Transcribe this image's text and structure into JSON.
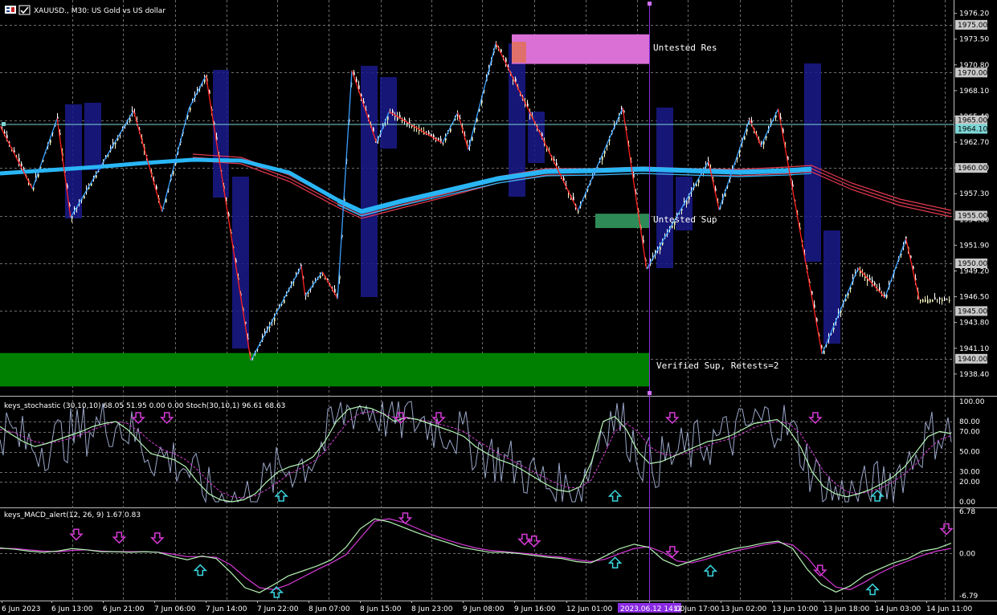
{
  "main_title": "XAUUSD., M30:  US Gold vs US dollar",
  "stoch_title": "keys_stochastic (30,10,10) 68.05 51.95 0.00 0.00 Stoch(30,10,1) 96.61 68.63",
  "macd_title": "keys_MACD_alert(12, 26, 9) 1.67 0.83",
  "zones": {
    "untested_res": "Untested Res",
    "untested_sup": "Untested Sup",
    "verified_sup": "Verified Sup, Retests=2"
  },
  "colors": {
    "background": "#000000",
    "grid": "#6e6e6e",
    "bull_candle": "#f5f5c0",
    "bear_candle": "#ffffff",
    "zigzag_up": "#3aa0ff",
    "zigzag_down": "#ff2020",
    "ma_blue": "#29b6f6",
    "ma_red": "#e53950",
    "res_zone": "#da70d6",
    "sup_zone": "#2e8b57",
    "verified_zone": "#008000",
    "box_fill": "#1a1a8c",
    "price_line": "#7fd7d7",
    "arrow_down": "#d63ad6",
    "arrow_up": "#3ad6e0",
    "stoch_main": "#b5f5b5",
    "stoch_signal": "#d63ad6",
    "stoch_raw": "#9aa6c8",
    "macd_main": "#b5f5b5",
    "macd_signal": "#d63ad6",
    "cursor_line": "#8a2be2",
    "time_highlight": "#8a2be2"
  },
  "chart_data": [
    {
      "type": "candlestick",
      "symbol": "XAUUSD.",
      "timeframe": "M30",
      "ylim": [
        1936.2,
        1977.6
      ],
      "y_ticks": [
        "1976.20",
        "1973.50",
        "1970.80",
        "1968.10",
        "1965.40",
        "1962.70",
        "1960.00",
        "1957.30",
        "1954.60",
        "1951.90",
        "1949.20",
        "1946.50",
        "1943.80",
        "1941.10",
        "1938.40"
      ],
      "price_labels": [
        "1975.00",
        "1970.00",
        "1965.00",
        "1964.10",
        "1960.00",
        "1955.00",
        "1950.00",
        "1945.00",
        "1940.00"
      ],
      "current_price": 1964.1,
      "zigzag_points": [
        {
          "x": 0.0,
          "y": 1964.4
        },
        {
          "x": 3.4,
          "y": 1957.8
        },
        {
          "x": 6.0,
          "y": 1965.2
        },
        {
          "x": 7.4,
          "y": 1954.8
        },
        {
          "x": 14.0,
          "y": 1966.0
        },
        {
          "x": 17.0,
          "y": 1955.4
        },
        {
          "x": 19.8,
          "y": 1966.2
        },
        {
          "x": 21.6,
          "y": 1969.7
        },
        {
          "x": 26.3,
          "y": 1939.8
        },
        {
          "x": 31.6,
          "y": 1949.7
        },
        {
          "x": 32.0,
          "y": 1946.6
        },
        {
          "x": 33.8,
          "y": 1949.1
        },
        {
          "x": 35.4,
          "y": 1946.3
        },
        {
          "x": 36.9,
          "y": 1970.2
        },
        {
          "x": 39.5,
          "y": 1962.6
        },
        {
          "x": 40.8,
          "y": 1965.9
        },
        {
          "x": 46.4,
          "y": 1962.6
        },
        {
          "x": 48.0,
          "y": 1965.8
        },
        {
          "x": 49.1,
          "y": 1961.9
        },
        {
          "x": 52.0,
          "y": 1973.1
        },
        {
          "x": 60.6,
          "y": 1955.5
        },
        {
          "x": 65.3,
          "y": 1966.3
        },
        {
          "x": 67.8,
          "y": 1949.4
        },
        {
          "x": 74.3,
          "y": 1960.7
        },
        {
          "x": 75.4,
          "y": 1955.6
        },
        {
          "x": 78.6,
          "y": 1965.1
        },
        {
          "x": 79.8,
          "y": 1962.3
        },
        {
          "x": 81.6,
          "y": 1966.2
        },
        {
          "x": 86.2,
          "y": 1940.5
        },
        {
          "x": 89.6,
          "y": 1948.6
        },
        {
          "x": 90.0,
          "y": 1949.5
        },
        {
          "x": 92.8,
          "y": 1946.4
        },
        {
          "x": 95.0,
          "y": 1952.6
        },
        {
          "x": 96.4,
          "y": 1946.2
        }
      ],
      "zones": [
        {
          "label": "Untested Res",
          "from": 1970.9,
          "to": 1974.0
        },
        {
          "label": "Untested Sup",
          "from": 1953.7,
          "to": 1955.2
        },
        {
          "label": "Verified Sup, Retests=2",
          "from": 1937.1,
          "to": 1940.6
        }
      ]
    },
    {
      "type": "line",
      "name": "keys_stochastic (30,10,10)",
      "ylim": [
        0,
        100
      ],
      "y_ticks": [
        "100.00",
        "80.00",
        "70.00",
        "50.00",
        "30.00",
        "20.00",
        "0.00"
      ],
      "series": [
        {
          "name": "main",
          "values": [
            75,
            67,
            60,
            55,
            58,
            62,
            66,
            70,
            75,
            78,
            80,
            72,
            60,
            48,
            45,
            42,
            35,
            20,
            8,
            2,
            0,
            2,
            8,
            20,
            30,
            35,
            38,
            45,
            60,
            80,
            92,
            95,
            93,
            88,
            80,
            84,
            82,
            78,
            74,
            70,
            65,
            55,
            48,
            42,
            38,
            32,
            25,
            18,
            12,
            10,
            15,
            40,
            80,
            85,
            72,
            50,
            38,
            40,
            45,
            50,
            55,
            60,
            62,
            66,
            72,
            78,
            80,
            82,
            72,
            55,
            30,
            15,
            8,
            5,
            8,
            12,
            18,
            25,
            35,
            50,
            65,
            70,
            68
          ]
        },
        {
          "name": "signal",
          "values": [
            72,
            70,
            65,
            60,
            58,
            60,
            63,
            67,
            72,
            76,
            80,
            78,
            70,
            60,
            52,
            48,
            42,
            32,
            20,
            10,
            5,
            4,
            6,
            12,
            20,
            28,
            34,
            40,
            50,
            65,
            80,
            88,
            90,
            88,
            84,
            83,
            82,
            80,
            77,
            74,
            70,
            62,
            55,
            48,
            42,
            36,
            30,
            24,
            18,
            14,
            14,
            22,
            45,
            70,
            78,
            70,
            55,
            48,
            46,
            48,
            52,
            56,
            60,
            63,
            68,
            74,
            78,
            80,
            78,
            68,
            50,
            30,
            18,
            10,
            8,
            10,
            14,
            20,
            28,
            38,
            52,
            62,
            66
          ]
        }
      ]
    },
    {
      "type": "line",
      "name": "keys_MACD_alert(12, 26, 9)",
      "ylim": [
        -6.79,
        6.78
      ],
      "y_ticks": [
        "6.78",
        "0.00",
        "-6.79"
      ],
      "series": [
        {
          "name": "macd",
          "values": [
            0.9,
            0.7,
            0.4,
            0.2,
            0.4,
            0.8,
            0.6,
            0.3,
            0.3,
            0.2,
            0.3,
            0.2,
            -0.5,
            -1.0,
            -0.4,
            -0.8,
            -3.0,
            -5.5,
            -6.3,
            -5.0,
            -3.6,
            -2.8,
            -2.0,
            -1.0,
            1.0,
            4.0,
            5.6,
            5.1,
            4.2,
            3.3,
            2.5,
            1.8,
            1.0,
            0.6,
            0.2,
            0.2,
            0.0,
            -0.3,
            -0.6,
            -0.8,
            -1.3,
            -1.5,
            -0.4,
            0.8,
            1.5,
            1.0,
            -1.0,
            -2.0,
            -1.2,
            -0.5,
            0.2,
            0.8,
            1.2,
            1.7,
            2.0,
            0.8,
            -2.5,
            -5.0,
            -6.2,
            -5.2,
            -3.5,
            -2.5,
            -1.5,
            -0.8,
            0.4,
            0.8,
            1.67
          ]
        },
        {
          "name": "signal",
          "values": [
            0.8,
            0.8,
            0.6,
            0.4,
            0.3,
            0.5,
            0.6,
            0.4,
            0.3,
            0.3,
            0.3,
            0.2,
            -0.1,
            -0.5,
            -0.5,
            -0.6,
            -1.8,
            -3.8,
            -5.5,
            -5.8,
            -5.0,
            -3.8,
            -2.6,
            -1.5,
            -0.2,
            2.5,
            5.2,
            5.6,
            5.0,
            4.0,
            3.0,
            2.2,
            1.5,
            0.9,
            0.5,
            0.3,
            0.1,
            -0.1,
            -0.4,
            -0.6,
            -1.0,
            -1.3,
            -0.9,
            0.0,
            0.8,
            1.1,
            0.2,
            -1.2,
            -1.5,
            -0.9,
            -0.2,
            0.4,
            0.9,
            1.4,
            1.8,
            1.4,
            -0.6,
            -3.4,
            -5.4,
            -5.8,
            -4.6,
            -3.2,
            -2.1,
            -1.2,
            -0.3,
            0.4,
            0.83
          ]
        }
      ]
    }
  ],
  "time_labels": [
    "6 Jun 2023",
    "6 Jun 13:00",
    "6 Jun 21:00",
    "7 Jun 06:00",
    "7 Jun 14:00",
    "7 Jun 22:00",
    "8 Jun 07:00",
    "8 Jun 15:00",
    "8 Jun 23:00",
    "9 Jun 08:00",
    "9 Jun 16:00",
    "12 Jun 01:00",
    "2023.06.12 14:00",
    "12 Jun 17:00",
    "13 Jun 02:00",
    "13 Jun 10:00",
    "13 Jun 18:00",
    "14 Jun 03:00",
    "14 Jun 11:00"
  ],
  "stoch_arrows": [
    {
      "dir": "down",
      "t": 0.145
    },
    {
      "dir": "down",
      "t": 0.175
    },
    {
      "dir": "up",
      "t": 0.295
    },
    {
      "dir": "down",
      "t": 0.42
    },
    {
      "dir": "down",
      "t": 0.46
    },
    {
      "dir": "up",
      "t": 0.645
    },
    {
      "dir": "down",
      "t": 0.705
    },
    {
      "dir": "down",
      "t": 0.855
    },
    {
      "dir": "up",
      "t": 0.92
    }
  ],
  "macd_arrows": [
    {
      "dir": "down",
      "t": 0.08
    },
    {
      "dir": "down",
      "t": 0.125
    },
    {
      "dir": "down",
      "t": 0.165
    },
    {
      "dir": "up",
      "t": 0.21
    },
    {
      "dir": "up",
      "t": 0.29
    },
    {
      "dir": "down",
      "t": 0.425
    },
    {
      "dir": "down",
      "t": 0.55
    },
    {
      "dir": "down",
      "t": 0.56
    },
    {
      "dir": "up",
      "t": 0.645
    },
    {
      "dir": "down",
      "t": 0.705
    },
    {
      "dir": "up",
      "t": 0.745
    },
    {
      "dir": "down",
      "t": 0.86
    },
    {
      "dir": "up",
      "t": 0.915
    },
    {
      "dir": "down",
      "t": 1.0
    }
  ]
}
